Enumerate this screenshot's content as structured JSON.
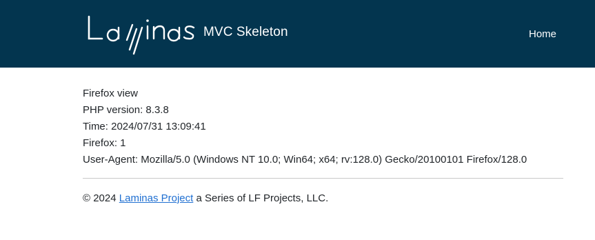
{
  "header": {
    "logo_text": "Laminas",
    "subtitle": "MVC Skeleton",
    "nav": {
      "home_label": "Home"
    },
    "colors": {
      "background": "#03354f",
      "text": "#ffffff"
    }
  },
  "main": {
    "lines": [
      "Firefox view",
      "PHP version: 8.3.8",
      "Time: 2024/07/31 13:09:41",
      "Firefox: 1",
      "User-Agent: Mozilla/5.0 (Windows NT 10.0; Win64; x64; rv:128.0) Gecko/20100101 Firefox/128.0"
    ]
  },
  "footer": {
    "prefix": "© 2024",
    "link_text": "Laminas Project",
    "suffix": "a Series of LF Projects, LLC.",
    "link_color": "#1f6fd1"
  }
}
